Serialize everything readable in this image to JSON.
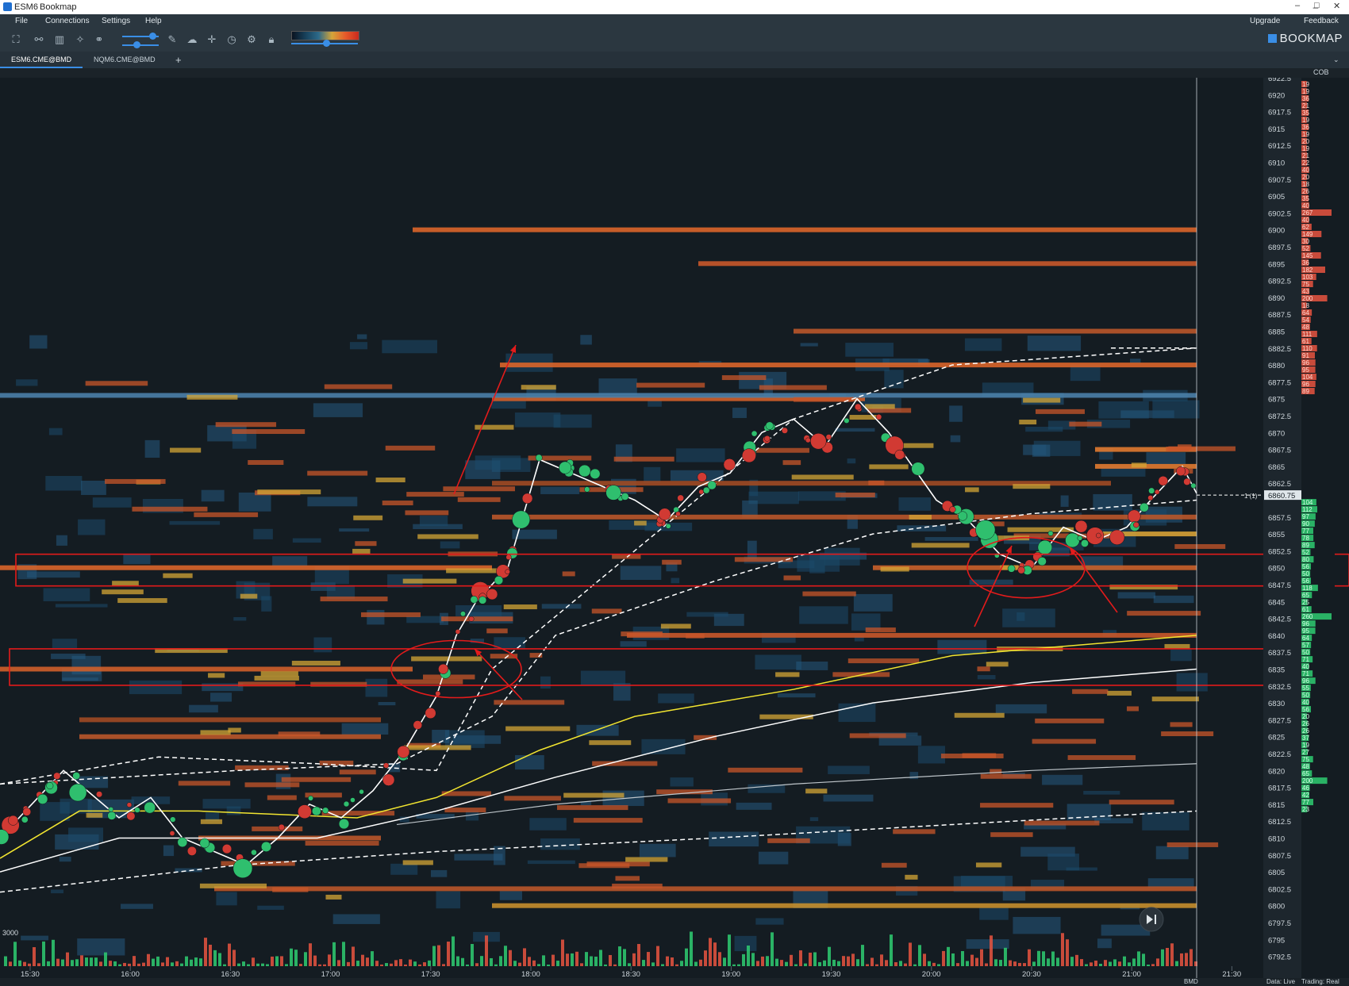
{
  "window": {
    "tab_title": "ESM6",
    "app_name": "Bookmap"
  },
  "menu": {
    "file": "File",
    "connections": "Connections",
    "settings": "Settings",
    "help": "Help",
    "upgrade": "Upgrade",
    "feedback": "Feedback"
  },
  "brand": {
    "logo_text": "BOOKMAP"
  },
  "tabs": [
    {
      "label": "ESM6.CME@BMD",
      "active": true
    },
    {
      "label": "NQM6.CME@BMD",
      "active": false
    }
  ],
  "cob_header": "COB",
  "price_axis": {
    "labels": [
      "6922.5",
      "6920",
      "6917.5",
      "6915",
      "6912.5",
      "6910",
      "6907.5",
      "6905",
      "6902.5",
      "6900",
      "6897.5",
      "6895",
      "6892.5",
      "6890",
      "6887.5",
      "6885",
      "6882.5",
      "6880",
      "6877.5",
      "6875",
      "6872.5",
      "6870",
      "6867.5",
      "6865",
      "6862.5",
      "6860.75",
      "6857.5",
      "6855",
      "6852.5",
      "6850",
      "6847.5",
      "6845",
      "6842.5",
      "6840",
      "6837.5",
      "6835",
      "6832.5",
      "6830",
      "6827.5",
      "6825",
      "6822.5",
      "6820",
      "6817.5",
      "6815",
      "6812.5",
      "6810",
      "6807.5",
      "6805",
      "6802.5",
      "6800",
      "6797.5",
      "6795",
      "6792.5"
    ],
    "last_price": "6860.75",
    "position_marker": "1 (1)"
  },
  "cob_values": {
    "ask": [
      "19",
      "19",
      "36",
      "21",
      "35",
      "19",
      "36",
      "19",
      "20",
      "19",
      "21",
      "22",
      "40",
      "20",
      "18",
      "26",
      "35",
      "40",
      "267",
      "40",
      "62",
      "149",
      "30",
      "52",
      "145",
      "36",
      "182",
      "103",
      "75",
      "43",
      "200",
      "18",
      "64",
      "54",
      "48",
      "111",
      "61",
      "110",
      "91",
      "96",
      "95",
      "104",
      "96",
      "89"
    ],
    "bid": [
      "104",
      "112",
      "97",
      "90",
      "77",
      "78",
      "89",
      "52",
      "80",
      "56",
      "50",
      "56",
      "118",
      "65",
      "25",
      "61",
      "260",
      "96",
      "95",
      "64",
      "57",
      "50",
      "71",
      "40",
      "71",
      "96",
      "55",
      "50",
      "40",
      "56",
      "20",
      "26",
      "26",
      "37",
      "19",
      "27",
      "75",
      "48",
      "65",
      "200",
      "46",
      "42",
      "77",
      "23"
    ]
  },
  "time_axis": {
    "labels": [
      "15:30",
      "16:00",
      "16:30",
      "17:00",
      "17:30",
      "18:00",
      "18:30",
      "19:00",
      "19:30",
      "20:00",
      "20:30",
      "21:00",
      "21:30"
    ]
  },
  "volume_label": "3000",
  "status": {
    "exchange": "BMD",
    "data": "Data: Live",
    "trading": "Trading: Real"
  },
  "colors": {
    "background": "#141c22",
    "ask": "#e8533f",
    "bid": "#2ecc71",
    "vwap": "#f2e530",
    "highlight": "#e31b1b",
    "heat_hot": "#d9652a",
    "heat_cold": "#1f4d6e"
  },
  "icons": [
    "fit-screen-icon",
    "share-icon",
    "chart-icon",
    "crosshair-icon",
    "link-icon",
    "volume-slider-icon",
    "pencil-icon",
    "comment-icon",
    "cursor-icon",
    "timer-icon",
    "settings-icon",
    "lock-icon",
    "color-scale-icon"
  ]
}
